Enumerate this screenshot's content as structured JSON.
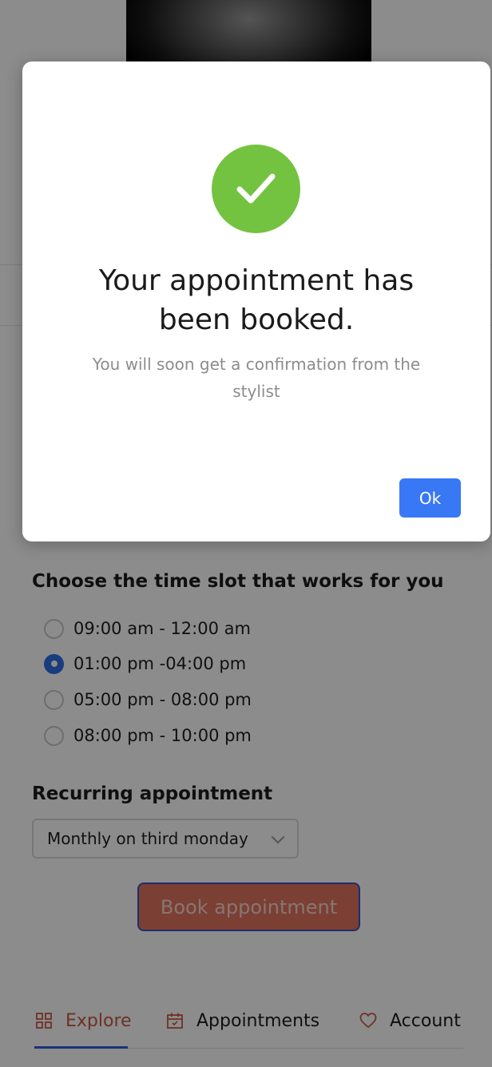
{
  "time_slots": {
    "title": "Choose the time slot that works for you",
    "options": [
      {
        "label": "09:00 am - 12:00 am",
        "selected": false
      },
      {
        "label": "01:00 pm -04:00 pm",
        "selected": true
      },
      {
        "label": "05:00 pm - 08:00 pm",
        "selected": false
      },
      {
        "label": "08:00 pm - 10:00 pm",
        "selected": false
      }
    ]
  },
  "recurring": {
    "title": "Recurring appointment",
    "selected": "Monthly on third monday"
  },
  "book_button": "Book appointment",
  "tabs": [
    {
      "label": "Explore",
      "icon": "grid-icon",
      "active": true
    },
    {
      "label": "Appointments",
      "icon": "calendar-icon",
      "active": false
    },
    {
      "label": "Account",
      "icon": "heart-icon",
      "active": false
    }
  ],
  "dialog": {
    "icon": "check-icon",
    "title": "Your appointment has been booked.",
    "message": "You will soon get a confirmation from the stylist",
    "ok_label": "Ok"
  },
  "colors": {
    "success": "#73c341",
    "primary": "#3978f5",
    "accent": "#e1735d"
  }
}
